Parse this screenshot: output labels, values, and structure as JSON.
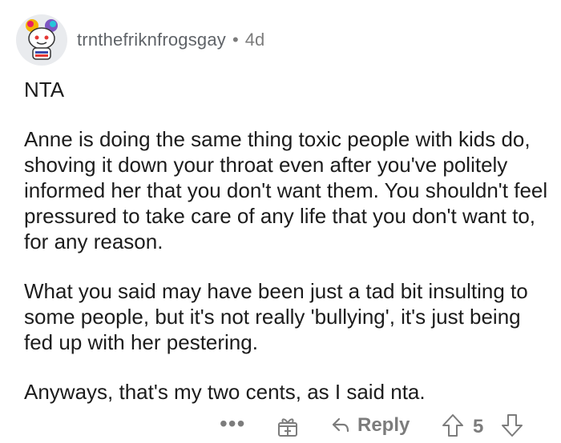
{
  "comment": {
    "username": "trnthefriknfrogsgay",
    "separator": "•",
    "age": "4d",
    "verdict": "NTA",
    "paragraphs": [
      "Anne is doing the same thing toxic people with kids do, shoving it down your throat even after you've politely informed her that you don't want them. You shouldn't feel pressured to take care of any life that you don't want to, for any reason.",
      "What you said may have been just a tad bit insulting to some people, but it's not really 'bullying', it's just being fed up with her pestering.",
      "Anyways, that's my two cents, as I said nta."
    ]
  },
  "actions": {
    "more": "•••",
    "reply_label": "Reply",
    "score": "5"
  },
  "icons": {
    "avatar": "snoo-avatar-icon",
    "award": "gift-award-icon",
    "reply": "reply-arrow-icon",
    "upvote": "upvote-arrow-icon",
    "downvote": "downvote-arrow-icon"
  },
  "colors": {
    "text": "#1c1c1c",
    "meta": "#7c7c7c",
    "avatar_bg": "#e9ebee"
  }
}
